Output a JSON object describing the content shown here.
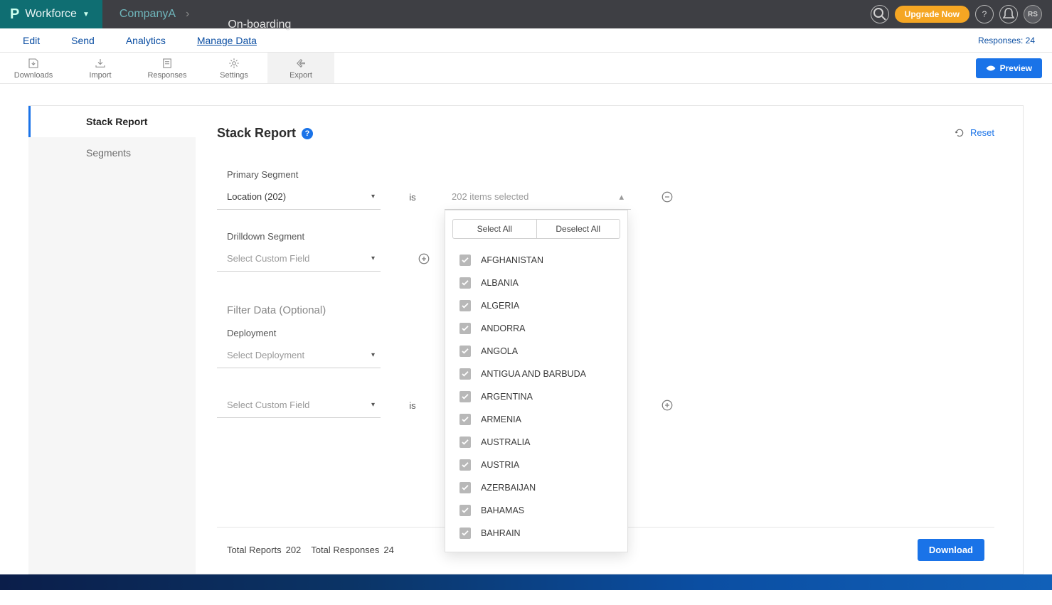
{
  "topbar": {
    "brand_label": "Workforce",
    "company": "CompanyA",
    "page": "On-boarding",
    "upgrade_label": "Upgrade Now",
    "avatar_initials": "RS"
  },
  "mainnav": {
    "items": [
      "Edit",
      "Send",
      "Analytics",
      "Manage Data"
    ],
    "active_index": 3,
    "responses_label": "Responses: 24"
  },
  "toolbar": {
    "items": [
      "Downloads",
      "Import",
      "Responses",
      "Settings",
      "Export"
    ],
    "active_index": 4,
    "preview_label": "Preview"
  },
  "sidenav": {
    "items": [
      "Stack Report",
      "Segments"
    ],
    "active_index": 0
  },
  "content": {
    "title": "Stack Report",
    "reset_label": "Reset",
    "primary_segment_label": "Primary Segment",
    "primary_segment_value": "Location (202)",
    "operator_is": "is",
    "multiselect_summary": "202 items selected",
    "drilldown_label": "Drilldown Segment",
    "drilldown_placeholder": "Select Custom Field",
    "filter_section_label": "Filter Data (Optional)",
    "deployment_label": "Deployment",
    "deployment_placeholder": "Select Deployment",
    "filter_field_placeholder": "Select Custom Field",
    "dropdown": {
      "select_all": "Select All",
      "deselect_all": "Deselect All",
      "options": [
        "AFGHANISTAN",
        "ALBANIA",
        "ALGERIA",
        "ANDORRA",
        "ANGOLA",
        "ANTIGUA AND BARBUDA",
        "ARGENTINA",
        "ARMENIA",
        "AUSTRALIA",
        "AUSTRIA",
        "AZERBAIJAN",
        "BAHAMAS",
        "BAHRAIN"
      ]
    }
  },
  "footer": {
    "total_reports_label": "Total Reports",
    "total_reports_value": "202",
    "total_responses_label": "Total Responses",
    "total_responses_value": "24",
    "download_label": "Download"
  }
}
